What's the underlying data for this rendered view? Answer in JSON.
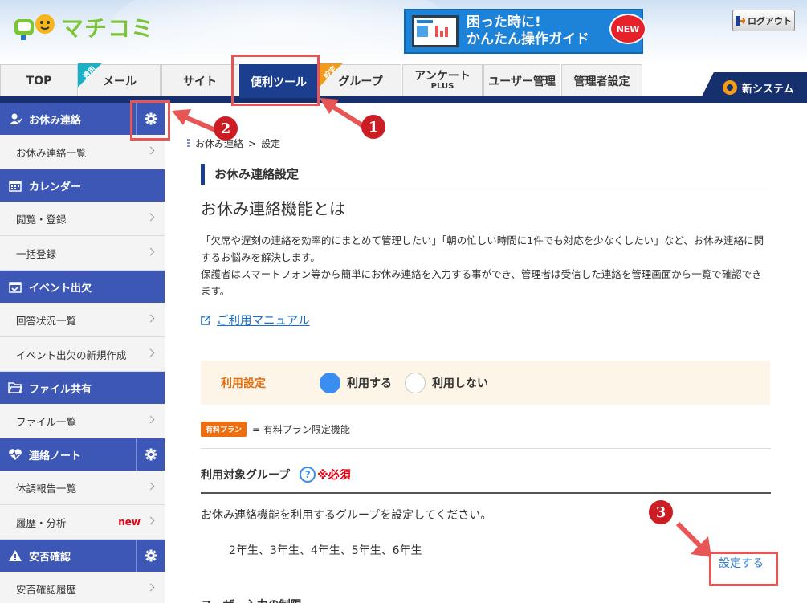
{
  "header": {
    "logo_text": "マチコミ",
    "banner_line1": "困った時に!",
    "banner_line2": "かんたん操作ガイド",
    "banner_new": "NEW",
    "logout_label": "ログアウト"
  },
  "tabs": [
    {
      "label": "TOP"
    },
    {
      "label": "メール",
      "badge": "週用"
    },
    {
      "label": "サイト"
    },
    {
      "label": "便利ツール"
    },
    {
      "label": "グループ",
      "badge": "設定"
    },
    {
      "label": "アンケート",
      "sub": "PLUS"
    },
    {
      "label": "ユーザー管理"
    },
    {
      "label": "管理者設定"
    }
  ],
  "new_system_label": "新システム",
  "sidebar": {
    "sections": [
      {
        "title": "お休み連絡",
        "items": [
          "お休み連絡一覧"
        ]
      },
      {
        "title": "カレンダー",
        "items": [
          "閲覧・登録",
          "一括登録"
        ]
      },
      {
        "title": "イベント出欠",
        "items": [
          "回答状況一覧",
          "イベント出欠の新規作成"
        ]
      },
      {
        "title": "ファイル共有",
        "items": [
          "ファイル一覧"
        ]
      },
      {
        "title": "連絡ノート",
        "items": [
          "体調報告一覧",
          "履歴・分析"
        ]
      },
      {
        "title": "安否確認",
        "items": [
          "安否確認履歴"
        ]
      }
    ],
    "new_badge": "new"
  },
  "main": {
    "breadcrumb_parent": "お休み連絡",
    "breadcrumb_sep": ">",
    "breadcrumb_current": "設定",
    "page_title": "お休み連絡設定",
    "heading": "お休み連絡機能とは",
    "desc1": "「欠席や遅刻の連絡を効率的にまとめて管理したい」「朝の忙しい時間に1件でも対応を少なくしたい」など、お休み連絡に関するお悩みを解決します。",
    "desc2": "保護者はスマートフォン等から簡単にお休み連絡を入力する事ができ、管理者は受信した連絡を管理画面から一覧で確認できます。",
    "manual_link": "ご利用マニュアル",
    "use_setting_label": "利用設定",
    "use_on": "利用する",
    "use_off": "利用しない",
    "plan_badge": "有料プラン",
    "plan_text": "= 有料プラン限定機能",
    "target_label": "利用対象グループ",
    "help_mark": "?",
    "required": "※必須",
    "group_desc": "お休み連絡機能を利用するグループを設定してください。",
    "group_list": "2年生、3年生、4年生、5年生、6年生",
    "set_button": "設定する",
    "next_heading": "ユーザー入力の制限"
  },
  "annotations": {
    "n1": "1",
    "n2": "2",
    "n3": "3"
  },
  "colors": {
    "nav_dark": "#162f6d",
    "tab_active": "#1b3e8f",
    "sidebar_head": "#3c57b6",
    "highlight": "#e75555",
    "accent_orange": "#e56d0e",
    "link": "#1a6fc9"
  }
}
